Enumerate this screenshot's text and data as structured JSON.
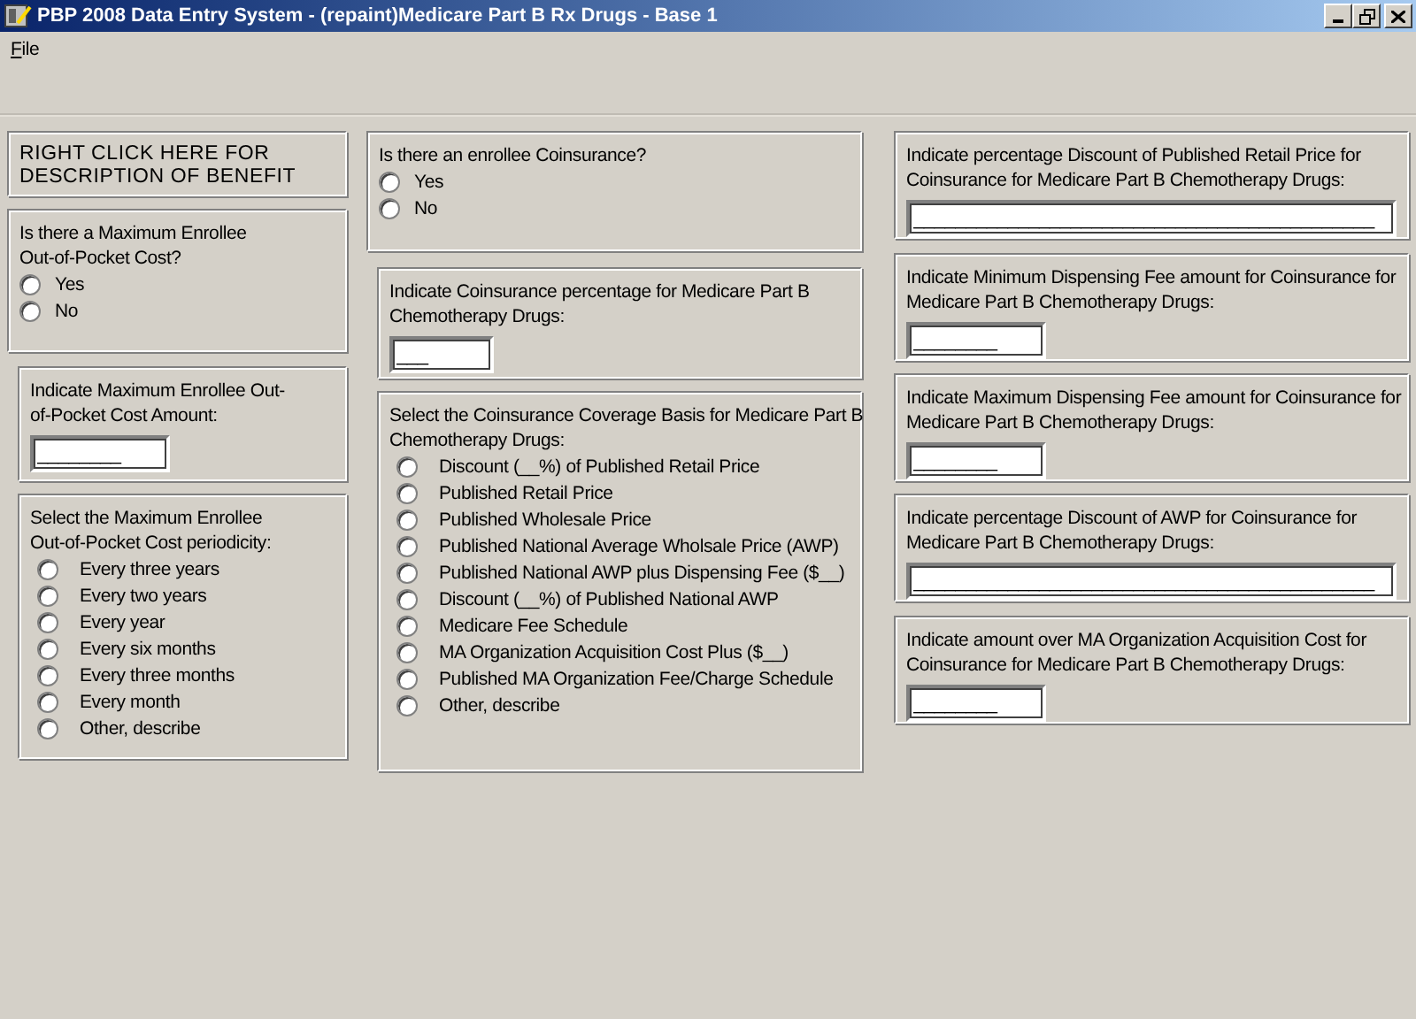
{
  "window": {
    "title": "PBP 2008 Data Entry System - (repaint)Medicare Part B Rx Drugs - Base 1"
  },
  "menu": [
    {
      "label": "File"
    }
  ],
  "columns": [
    [
      {
        "kind": "note",
        "label": "RIGHT CLICK HERE FOR DESCRIPTION OF BENEFIT"
      },
      {
        "kind": "radio",
        "label": "Is there a Maximum Enrollee Out-of-Pocket Cost?",
        "options": [
          {
            "label": "Yes",
            "selected": false
          },
          {
            "label": "No",
            "selected": false
          }
        ]
      },
      {
        "kind": "field",
        "label": "Indicate Maximum Enrollee Out-of-Pocket Cost Amount:",
        "value": "________"
      },
      {
        "kind": "radio",
        "label": "Select the Maximum Enrollee Out-of-Pocket Cost periodicity:",
        "options": [
          {
            "label": "Every three years",
            "selected": false
          },
          {
            "label": "Every two years",
            "selected": false
          },
          {
            "label": "Every year",
            "selected": false
          },
          {
            "label": "Every six months",
            "selected": false
          },
          {
            "label": "Every three months",
            "selected": false
          },
          {
            "label": "Every month",
            "selected": false
          },
          {
            "label": "Other, describe",
            "selected": false
          }
        ]
      }
    ],
    [
      {
        "kind": "radio",
        "label": "Is there an enrollee Coinsurance?",
        "options": [
          {
            "label": "Yes",
            "selected": false
          },
          {
            "label": "No",
            "selected": false
          }
        ]
      },
      {
        "kind": "field",
        "label": "Indicate Coinsurance percentage for Medicare Part B Chemotherapy Drugs:",
        "value": "___"
      },
      {
        "kind": "radio",
        "label": "Select the Coinsurance Coverage Basis for Medicare Part B Chemotherapy Drugs:",
        "options": [
          {
            "label": "Discount (__%) of Published Retail Price",
            "selected": false
          },
          {
            "label": "Published Retail Price",
            "selected": false
          },
          {
            "label": "Published Wholesale Price",
            "selected": false
          },
          {
            "label": "Published National Average Wholsale Price (AWP)",
            "selected": false
          },
          {
            "label": "Published National AWP plus Dispensing Fee ($__)",
            "selected": false
          },
          {
            "label": "Discount (__%) of Published National AWP",
            "selected": false
          },
          {
            "label": "Medicare Fee Schedule",
            "selected": false
          },
          {
            "label": "MA Organization Acquisition Cost Plus ($__)",
            "selected": false
          },
          {
            "label": "Published MA Organization Fee/Charge Schedule",
            "selected": false
          },
          {
            "label": "Other, describe",
            "selected": false
          }
        ]
      }
    ],
    [
      {
        "kind": "field",
        "label": "Indicate percentage Discount of Published Retail Price for Coinsurance for Medicare Part B Chemotherapy Drugs:",
        "value": "____________________________________________"
      },
      {
        "kind": "field",
        "label": "Indicate Minimum Dispensing Fee amount for Coinsurance for Medicare Part B Chemotherapy Drugs:",
        "value": "________"
      },
      {
        "kind": "field",
        "label": "Indicate Maximum Dispensing Fee amount for Coinsurance for Medicare Part B Chemotherapy Drugs:",
        "value": "________"
      },
      {
        "kind": "field",
        "label": "Indicate percentage Discount of AWP for Coinsurance for Medicare Part B Chemotherapy Drugs:",
        "value": "____________________________________________"
      },
      {
        "kind": "field",
        "label": "Indicate amount over MA Organization Acquisition Cost for Coinsurance for Medicare Part B Chemotherapy Drugs:",
        "value": "________"
      }
    ]
  ]
}
